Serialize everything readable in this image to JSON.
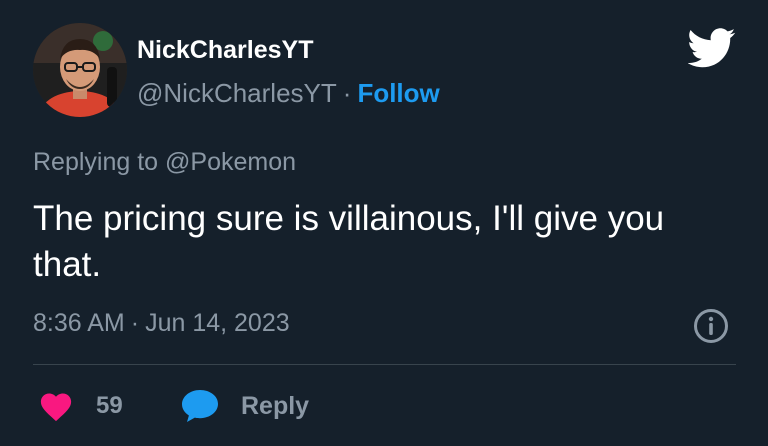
{
  "author": {
    "display_name": "NickCharlesYT",
    "handle": "@NickCharlesYT",
    "follow_label": "Follow",
    "avatar_icon": "profile-photo"
  },
  "header": {
    "separator": "·",
    "logo_icon": "twitter-bird-icon"
  },
  "reply_context": {
    "prefix": "Replying to",
    "mention": "@Pokemon"
  },
  "tweet": {
    "text": "The pricing sure is villainous, I'll give you that."
  },
  "meta": {
    "time": "8:36 AM",
    "separator": "·",
    "date": "Jun 14, 2023",
    "info_icon": "info-icon"
  },
  "actions": {
    "like_count": "59",
    "like_icon": "heart-icon",
    "reply_label": "Reply",
    "reply_icon": "speech-bubble-icon"
  },
  "colors": {
    "background": "#15202b",
    "primary_text": "#ffffff",
    "secondary_text": "#8b98a5",
    "accent_blue": "#1d9bf0",
    "like_pink": "#f91880",
    "divider": "#38444d"
  }
}
